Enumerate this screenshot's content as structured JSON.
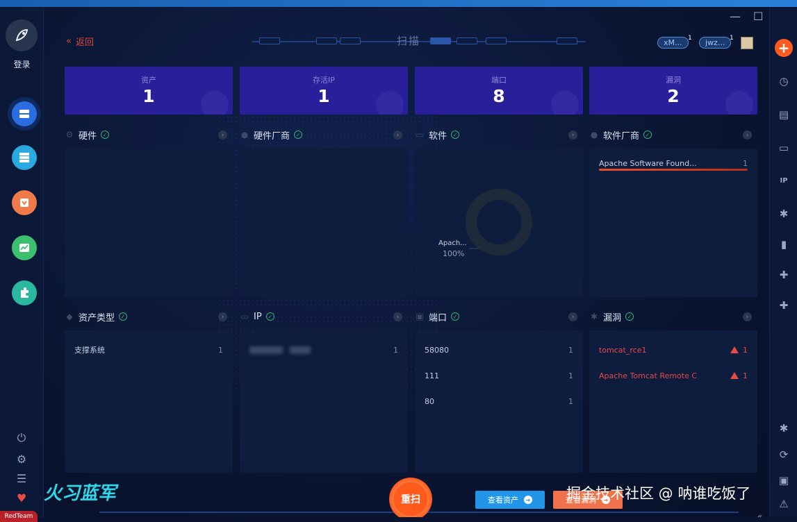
{
  "sidebar": {
    "login_label": "登录",
    "team_label": "RedTeam"
  },
  "header": {
    "back_label": "返回",
    "title": "扫描",
    "users": [
      {
        "name": "xM...",
        "badge": "1"
      },
      {
        "name": "jwz...",
        "badge": "1"
      }
    ]
  },
  "stats": [
    {
      "label": "资产",
      "value": "1"
    },
    {
      "label": "存活IP",
      "value": "1"
    },
    {
      "label": "端口",
      "value": "8"
    },
    {
      "label": "漏洞",
      "value": "2"
    }
  ],
  "sections_top": [
    {
      "title": "硬件"
    },
    {
      "title": "硬件厂商"
    },
    {
      "title": "软件",
      "donut_label": "Apach...",
      "donut_pct": "100%"
    },
    {
      "title": "软件厂商",
      "rows": [
        {
          "name": "Apache Software Found...",
          "count": "1"
        }
      ]
    }
  ],
  "sections_bottom": [
    {
      "title": "资产类型",
      "rows": [
        {
          "name": "支撑系统",
          "count": "1"
        }
      ]
    },
    {
      "title": "IP",
      "rows": [
        {
          "name": "",
          "count": "1"
        }
      ]
    },
    {
      "title": "端口",
      "rows": [
        {
          "name": "58080",
          "count": "1"
        },
        {
          "name": "111",
          "count": "1"
        },
        {
          "name": "80",
          "count": "1"
        }
      ]
    },
    {
      "title": "漏洞",
      "rows": [
        {
          "name": "tomcat_rce1",
          "count": "1"
        },
        {
          "name": "Apache Tomcat Remote C",
          "count": "1"
        }
      ]
    }
  ],
  "footer": {
    "rescan_label": "重扫",
    "view_assets_label": "查看资产",
    "view_vulns_label": "查看漏洞",
    "watermark": "掘金技术社区 @ 呐谁吃饭了",
    "decor_text": "火习蓝军"
  },
  "colors": {
    "accent": "#ff5a1e",
    "stat_card": "#2a1f9a",
    "vuln_red": "#e84a46",
    "check_green": "#2fb36b",
    "primary_blue": "#2196e8"
  }
}
